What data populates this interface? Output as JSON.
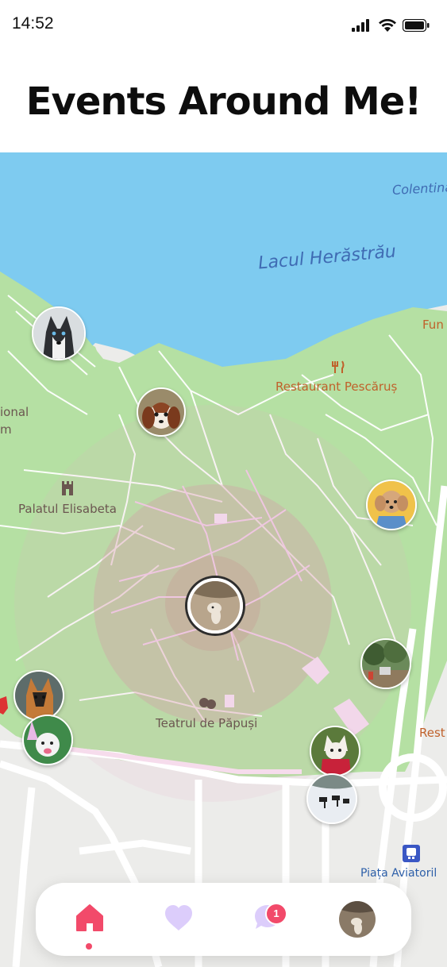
{
  "status_bar": {
    "time": "14:52",
    "icons": [
      "signal-icon",
      "wifi-icon",
      "battery-icon"
    ]
  },
  "page_title": "Events Around Me!",
  "map": {
    "labels": {
      "lake": "Lacul Herăstrău",
      "colentina": "Colentina",
      "restaurant": "Restaurant Pescăruș",
      "palace": "Palatul Elisabeta",
      "theatre": "Teatrul de Păpuși",
      "national_top": "ional",
      "national_bottom": "m",
      "fun": "Fun",
      "rest": "Rest",
      "piata": "Piața Aviatoril"
    },
    "markers": [
      {
        "name": "husky"
      },
      {
        "name": "cavalier"
      },
      {
        "name": "poodle-yellow"
      },
      {
        "name": "user-location"
      },
      {
        "name": "park-event"
      },
      {
        "name": "german-shepherd"
      },
      {
        "name": "party-dog"
      },
      {
        "name": "dog-costume"
      },
      {
        "name": "snow-dogs"
      }
    ]
  },
  "nav": {
    "items": [
      {
        "name": "home",
        "icon": "home-icon",
        "active": true
      },
      {
        "name": "favorites",
        "icon": "heart-icon",
        "active": false
      },
      {
        "name": "messages",
        "icon": "chat-icon",
        "active": false,
        "badge": "1"
      },
      {
        "name": "profile",
        "icon": "avatar",
        "active": false
      }
    ]
  },
  "colors": {
    "water": "#7ecbf0",
    "park": "#b5e0a3",
    "accent": "#f24a6a",
    "lavender": "#dccdfb",
    "land": "#ececea"
  }
}
